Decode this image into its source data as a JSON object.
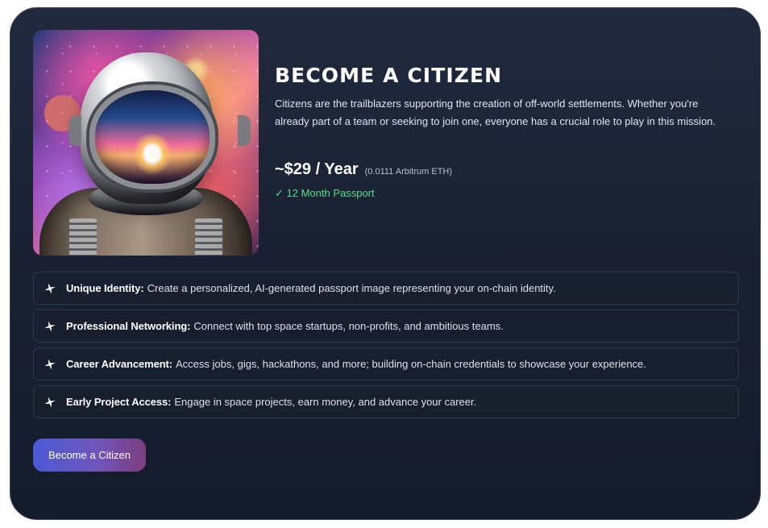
{
  "card": {
    "image": {
      "alt": "Astronaut in a space helmet with a colorful nebula background"
    },
    "title": "BECOME A CITIZEN",
    "description": "Citizens are the trailblazers supporting the creation of off-world settlements. Whether you're already part of a team or seeking to join one, everyone has a crucial role to play in this mission.",
    "price": "~$29 / Year",
    "eth_price": "(0.0111 Arbitrum ETH)",
    "passport": "✓ 12 Month Passport",
    "features": [
      {
        "title": "Unique Identity:",
        "text": "Create a personalized, AI-generated passport image representing your on-chain identity.",
        "icon": "star-sparkle-icon"
      },
      {
        "title": "Professional Networking:",
        "text": "Connect with top space startups, non-profits, and ambitious teams.",
        "icon": "star-sparkle-icon"
      },
      {
        "title": "Career Advancement:",
        "text": "Access jobs, gigs, hackathons, and more; building on-chain credentials to showcase your experience.",
        "icon": "star-sparkle-icon"
      },
      {
        "title": "Early Project Access:",
        "text": "Engage in space projects, earn money, and advance your career.",
        "icon": "star-sparkle-icon"
      }
    ],
    "button_label": "Become a Citizen"
  },
  "colors": {
    "card_background": "#1a2133",
    "accent_green": "#4fe08a",
    "button_start": "#4b5bd5",
    "button_end": "#7d3e7e",
    "feature_border": "#303949"
  }
}
